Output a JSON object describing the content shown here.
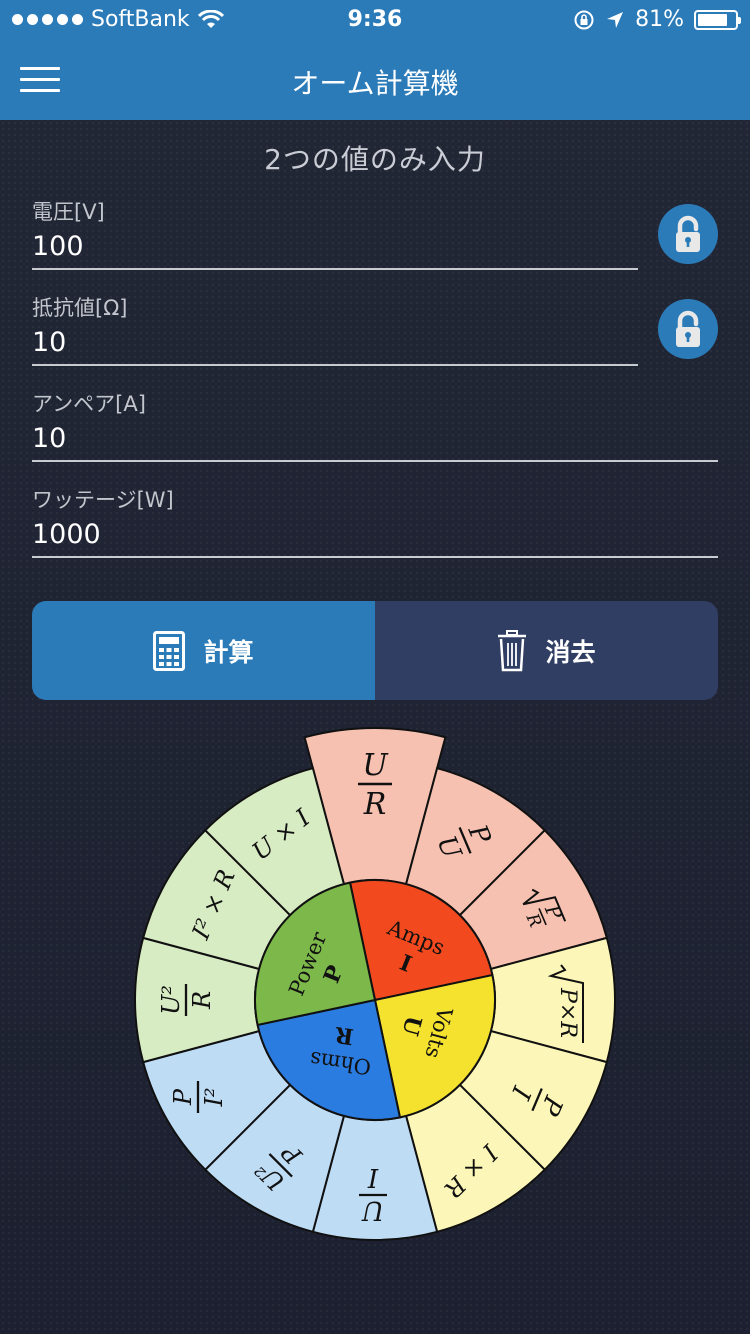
{
  "status": {
    "carrier": "SoftBank",
    "time": "9:36",
    "battery": "81%",
    "battery_level": 0.81
  },
  "nav": {
    "title": "オーム計算機"
  },
  "hint": "2つの値のみ入力",
  "fields": [
    {
      "label": "電圧[V]",
      "value": "100"
    },
    {
      "label": "抵抗値[Ω]",
      "value": "10"
    },
    {
      "label": "アンペア[A]",
      "value": "10"
    },
    {
      "label": "ワッテージ[W]",
      "value": "1000"
    }
  ],
  "buttons": {
    "calc": "計算",
    "clear": "消去"
  },
  "wheel": {
    "quadrants": {
      "amps": {
        "name": "Amps",
        "symbol": "I"
      },
      "volts": {
        "name": "Volts",
        "symbol": "U"
      },
      "ohms": {
        "name": "Ohms",
        "symbol": "R"
      },
      "power": {
        "name": "Power",
        "symbol": "P"
      }
    },
    "formulas": {
      "u": "U",
      "r": "R",
      "p": "P",
      "i": "I",
      "u_times_i": "U × I",
      "i2_times_r": "I² × R",
      "u2": "U²",
      "i2": "I²",
      "p_times_r": "P×R",
      "i_times_r": "I × R"
    },
    "colors": {
      "amps": "#f24a1e",
      "volts": "#f5e22e",
      "ohms": "#2b7ce0",
      "power": "#7cb84a",
      "amps_outer": "#f6c1b0",
      "volts_outer": "#fcf7b8",
      "ohms_outer": "#bfdcf5",
      "power_outer": "#d8ecc4"
    }
  }
}
